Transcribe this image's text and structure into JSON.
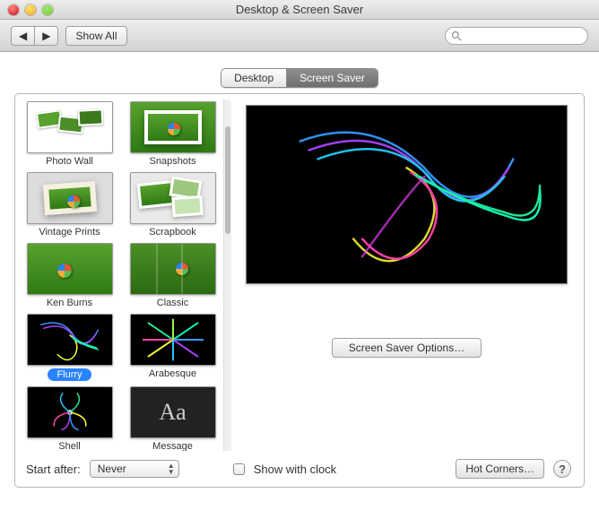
{
  "window": {
    "title": "Desktop & Screen Saver"
  },
  "toolbar": {
    "back_glyph": "◀",
    "fwd_glyph": "▶",
    "show_all": "Show All",
    "search_placeholder": ""
  },
  "tabs": {
    "items": [
      "Desktop",
      "Screen Saver"
    ],
    "active_index": 1
  },
  "gallery": {
    "items": [
      {
        "label": "Photo Wall",
        "style": "photowall"
      },
      {
        "label": "Snapshots",
        "style": "snap"
      },
      {
        "label": "Vintage Prints",
        "style": "vintage"
      },
      {
        "label": "Scrapbook",
        "style": "scrap"
      },
      {
        "label": "Ken Burns",
        "style": "ken"
      },
      {
        "label": "Classic",
        "style": "classic"
      },
      {
        "label": "Flurry",
        "style": "flurry",
        "selected": true
      },
      {
        "label": "Arabesque",
        "style": "arab"
      },
      {
        "label": "Shell",
        "style": "shell"
      },
      {
        "label": "Message",
        "style": "msg"
      }
    ]
  },
  "preview": {
    "options_label": "Screen Saver Options…"
  },
  "bottom": {
    "start_label": "Start after:",
    "start_value": "Never",
    "clock_label": "Show with clock",
    "clock_checked": false,
    "hotcorners_label": "Hot Corners…",
    "help_glyph": "?"
  }
}
